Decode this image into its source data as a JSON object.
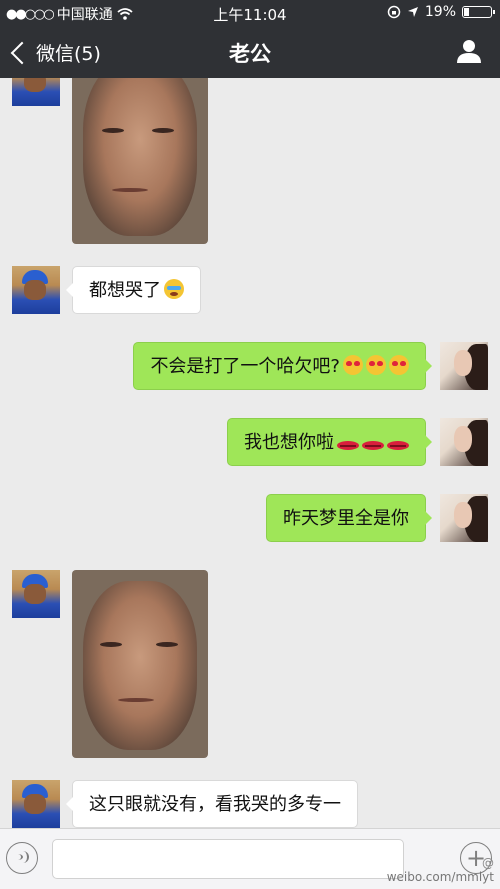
{
  "status": {
    "signal_dots": "●●○○○",
    "carrier": "中国联通",
    "wifi_icon": "wifi-icon",
    "time": "上午11:04",
    "battery_percent": "19%",
    "battery_level": 0.19
  },
  "nav": {
    "back_label": "微信(5)",
    "title": "老公"
  },
  "messages": [
    {
      "from": "him",
      "type": "image",
      "description_icon": "photo"
    },
    {
      "from": "him",
      "type": "text",
      "text": "都想哭了",
      "emoji": [
        "crying"
      ]
    },
    {
      "from": "her",
      "type": "text",
      "text": "不会是打了一个哈欠吧?",
      "emoji": [
        "heart-eyes",
        "heart-eyes",
        "heart-eyes"
      ]
    },
    {
      "from": "her",
      "type": "text",
      "text": "我也想你啦",
      "emoji": [
        "lips",
        "lips",
        "lips"
      ]
    },
    {
      "from": "her",
      "type": "text",
      "text": "昨天梦里全是你",
      "emoji": []
    },
    {
      "from": "him",
      "type": "image",
      "description_icon": "photo"
    },
    {
      "from": "him",
      "type": "text",
      "text": "这只眼就没有，看我哭的多专一",
      "emoji": []
    }
  ],
  "input": {
    "value": "",
    "placeholder": ""
  },
  "watermark": {
    "line1": "@",
    "line2": "weibo.com/mmlyt"
  }
}
